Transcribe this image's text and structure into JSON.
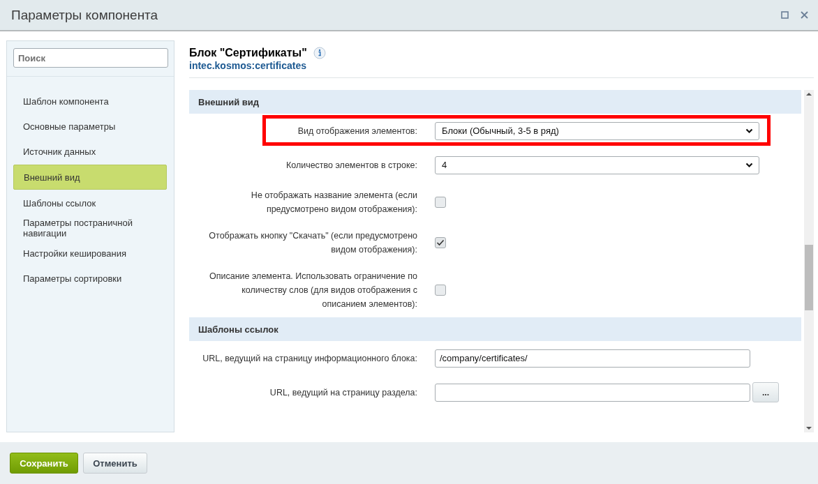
{
  "window": {
    "title": "Параметры компонента"
  },
  "sidebar": {
    "search": {
      "placeholder": "Поиск"
    },
    "items": [
      {
        "label": "Шаблон компонента",
        "selected": false
      },
      {
        "label": "Основные параметры",
        "selected": false
      },
      {
        "label": "Источник данных",
        "selected": false
      },
      {
        "label": "Внешний вид",
        "selected": true
      },
      {
        "label": "Шаблоны ссылок",
        "selected": false
      },
      {
        "label": "Параметры постраничной навигации",
        "selected": false
      },
      {
        "label": "Настройки кеширования",
        "selected": false
      },
      {
        "label": "Параметры сортировки",
        "selected": false
      }
    ]
  },
  "component": {
    "title": "Блок \"Сертификаты\"",
    "code": "intec.kosmos:certificates"
  },
  "sections": [
    {
      "title": "Внешний вид",
      "rows": [
        {
          "kind": "select",
          "label": "Вид отображения элементов:",
          "value": "Блоки (Обычный, 3-5 в ряд)",
          "highlighted": true
        },
        {
          "kind": "select",
          "label": "Количество элементов в строке:",
          "value": "4",
          "highlighted": false
        },
        {
          "kind": "checkbox",
          "label": "Не отображать название элемента (если предусмотрено видом отображения):",
          "checked": false,
          "highlighted": false
        },
        {
          "kind": "checkbox",
          "label": "Отображать кнопку \"Скачать\" (если предусмотрено видом отображения):",
          "checked": true,
          "highlighted": false
        },
        {
          "kind": "checkbox",
          "label": "Описание элемента. Использовать ограничение по количеству слов (для видов отображения с описанием элементов):",
          "checked": false,
          "highlighted": false
        }
      ]
    },
    {
      "title": "Шаблоны ссылок",
      "rows": [
        {
          "kind": "text",
          "label": "URL, ведущий на страницу информационного блока:",
          "value": "/company/certificates/",
          "highlighted": false
        },
        {
          "kind": "text_button",
          "label": "URL, ведущий на страницу раздела:",
          "value": "",
          "button": "...",
          "highlighted": false
        }
      ]
    }
  ],
  "buttons": [
    {
      "label": "Сохранить",
      "kind": "primary"
    },
    {
      "label": "Отменить",
      "kind": "secondary"
    }
  ]
}
